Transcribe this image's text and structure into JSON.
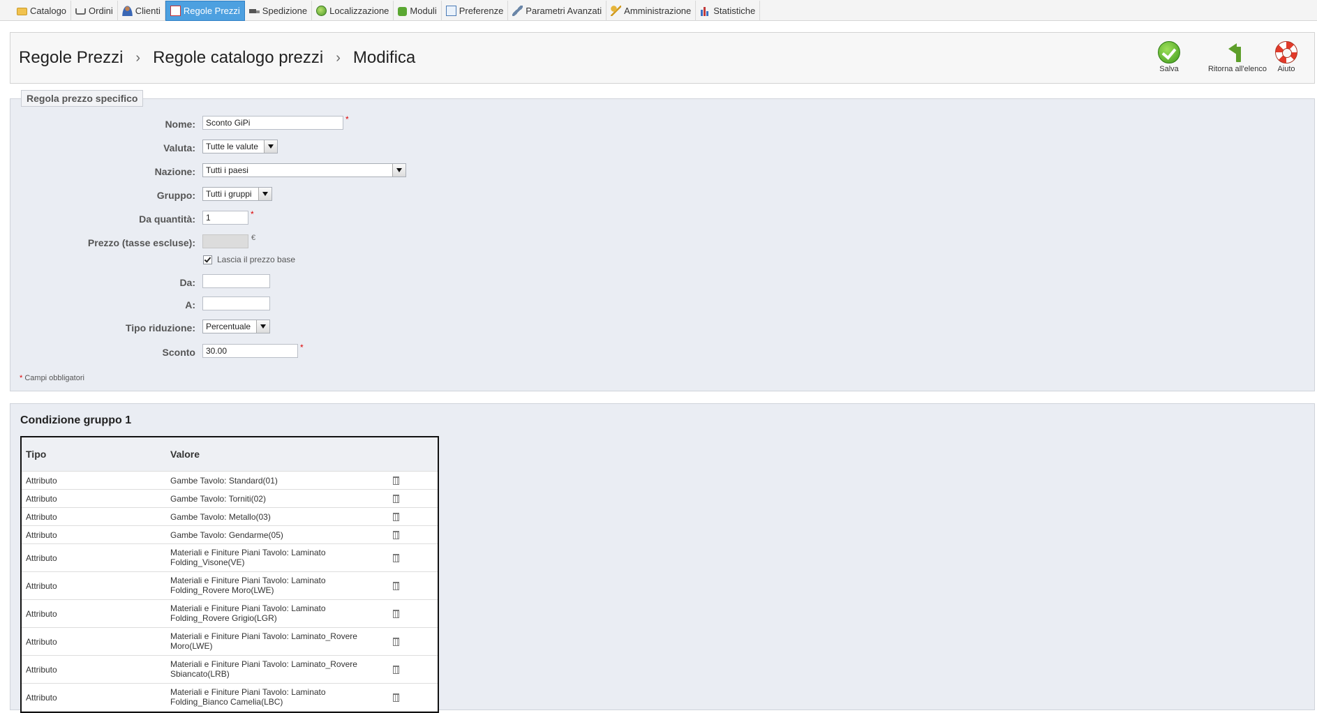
{
  "nav": {
    "tabs": [
      {
        "label": "Catalogo",
        "icon": "folder-icon"
      },
      {
        "label": "Ordini",
        "icon": "cart-icon"
      },
      {
        "label": "Clienti",
        "icon": "customers-icon"
      },
      {
        "label": "Regole Prezzi",
        "icon": "price-rules-icon",
        "active": true
      },
      {
        "label": "Spedizione",
        "icon": "truck-icon"
      },
      {
        "label": "Localizzazione",
        "icon": "globe-icon"
      },
      {
        "label": "Moduli",
        "icon": "puzzle-icon"
      },
      {
        "label": "Preferenze",
        "icon": "preferences-icon"
      },
      {
        "label": "Parametri Avanzati",
        "icon": "wrench-icon"
      },
      {
        "label": "Amministrazione",
        "icon": "key-icon"
      },
      {
        "label": "Statistiche",
        "icon": "stats-icon"
      }
    ]
  },
  "header": {
    "breadcrumb": [
      "Regole Prezzi",
      "Regole catalogo prezzi",
      "Modifica"
    ],
    "separator": "›",
    "actions": {
      "save": "Salva",
      "back": "Ritorna all'elenco",
      "help": "Aiuto"
    }
  },
  "form": {
    "legend": "Regola prezzo specifico",
    "required_mark": "*",
    "currency_symbol": "€",
    "fields": {
      "name": {
        "label": "Nome:",
        "value": "Sconto GiPi"
      },
      "currency": {
        "label": "Valuta:",
        "value": "Tutte le valute"
      },
      "country": {
        "label": "Nazione:",
        "value": "Tutti i paesi"
      },
      "group": {
        "label": "Gruppo:",
        "value": "Tutti i gruppi"
      },
      "from_quantity": {
        "label": "Da quantità:",
        "value": "1"
      },
      "price": {
        "label": "Prezzo (tasse escluse):",
        "value": ""
      },
      "leave_base_price": {
        "label": "Lascia il prezzo base",
        "checked": true
      },
      "from": {
        "label": "Da:",
        "value": ""
      },
      "to": {
        "label": "A:",
        "value": ""
      },
      "reduction_type": {
        "label": "Tipo riduzione:",
        "value": "Percentuale"
      },
      "discount": {
        "label": "Sconto",
        "value": "30.00"
      }
    },
    "footnote": "Campi obbligatori"
  },
  "conditions": {
    "title": "Condizione gruppo 1",
    "columns": [
      "Tipo",
      "Valore"
    ],
    "rows": [
      {
        "type": "Attributo",
        "value": "Gambe Tavolo: Standard(01)"
      },
      {
        "type": "Attributo",
        "value": "Gambe Tavolo: Torniti(02)"
      },
      {
        "type": "Attributo",
        "value": "Gambe Tavolo: Metallo(03)"
      },
      {
        "type": "Attributo",
        "value": "Gambe Tavolo: Gendarme(05)"
      },
      {
        "type": "Attributo",
        "value": "Materiali e Finiture Piani Tavolo: Laminato Folding_Visone(VE)"
      },
      {
        "type": "Attributo",
        "value": "Materiali e Finiture Piani Tavolo: Laminato Folding_Rovere Moro(LWE)"
      },
      {
        "type": "Attributo",
        "value": "Materiali e Finiture Piani Tavolo: Laminato Folding_Rovere Grigio(LGR)"
      },
      {
        "type": "Attributo",
        "value": "Materiali e Finiture Piani Tavolo: Laminato_Rovere Moro(LWE)"
      },
      {
        "type": "Attributo",
        "value": "Materiali e Finiture Piani Tavolo: Laminato_Rovere Sbiancato(LRB)"
      },
      {
        "type": "Attributo",
        "value": "Materiali e Finiture Piani Tavolo: Laminato Folding_Bianco Camelia(LBC)"
      }
    ]
  }
}
